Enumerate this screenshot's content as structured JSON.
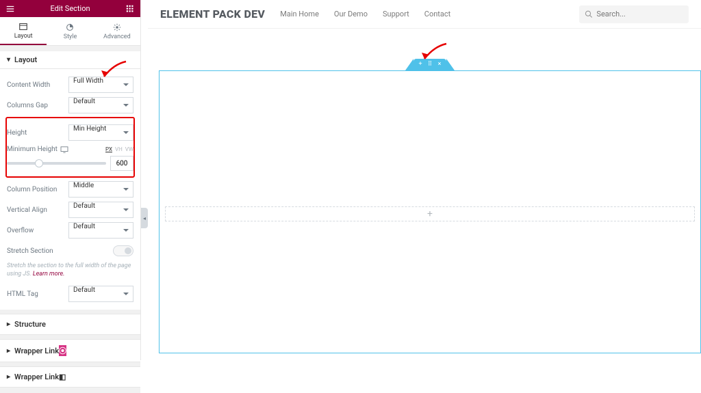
{
  "panel": {
    "title": "Edit Section",
    "tabs": {
      "layout": "Layout",
      "style": "Style",
      "advanced": "Advanced"
    },
    "sections": {
      "layout": "Layout",
      "structure": "Structure",
      "wrapper_link1": "Wrapper Link",
      "wrapper_link2": "Wrapper Link"
    },
    "fields": {
      "content_width": {
        "label": "Content Width",
        "value": "Full Width"
      },
      "columns_gap": {
        "label": "Columns Gap",
        "value": "Default"
      },
      "height": {
        "label": "Height",
        "value": "Min Height"
      },
      "min_height": {
        "label": "Minimum Height",
        "value": "600",
        "units": [
          "PX",
          "VH",
          "VW"
        ],
        "active_unit": "PX"
      },
      "column_position": {
        "label": "Column Position",
        "value": "Middle"
      },
      "vertical_align": {
        "label": "Vertical Align",
        "value": "Default"
      },
      "overflow": {
        "label": "Overflow",
        "value": "Default"
      },
      "stretch": {
        "label": "Stretch Section",
        "help": "Stretch the section to the full width of the page using JS.",
        "learn": "Learn more."
      },
      "html_tag": {
        "label": "HTML Tag",
        "value": "Default"
      }
    }
  },
  "preview": {
    "brand": "ELEMENT PACK DEV",
    "nav": [
      "Main Home",
      "Our Demo",
      "Support",
      "Contact"
    ],
    "search_placeholder": "Search...",
    "drop_plus": "+"
  }
}
